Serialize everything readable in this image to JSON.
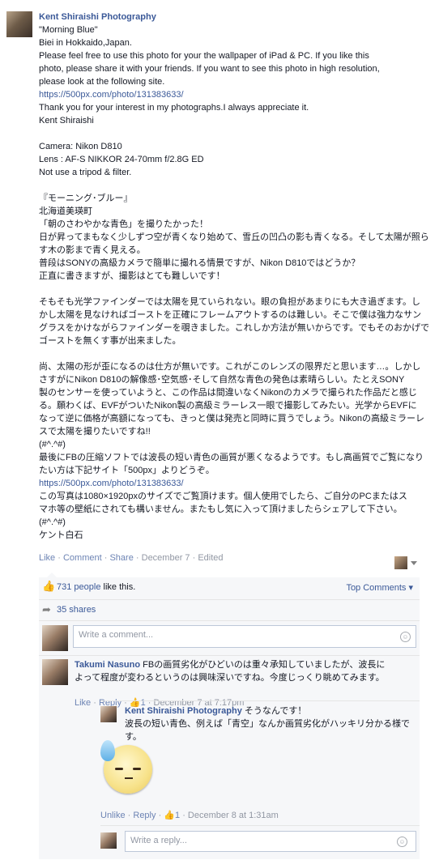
{
  "post": {
    "author": "Kent Shiraishi Photography",
    "lines": [
      "\"Morning Blue\"",
      "Biei in Hokkaido,Japan.",
      "Please feel free to use this photo for your the wallpaper of iPad & PC. If you like this",
      "photo, please share it with your friends. If you want to see this photo in high resolution,",
      "please look at the following site.",
      "https://500px.com/photo/131383633/",
      "Thank you for your interest in my photographs.I always appreciate it.",
      "Kent Shiraishi",
      "",
      "Camera: Nikon D810",
      "Lens : AF-S NIKKOR 24-70mm f/2.8G ED",
      "Not use a tripod & filter.",
      "",
      "『モーニング･ブルー』",
      "北海道美瑛町",
      "「朝のさわやかな青色」を撮りたかった！",
      "日が昇ってまもなく少しずつ空が青くなり始めて、雪丘の凹凸の影も青くなる。そして太陽が照ら",
      "す木の影まで青く見える。",
      "普段はSONYの高級カメラで簡単に撮れる情景ですが、Nikon D810ではどうか？",
      "正直に書きますが、撮影はとても難しいです！",
      "",
      "そもそも光学ファインダーでは太陽を見ていられない。眼の負担があまりにも大き過ぎます。し",
      "かし太陽を見なければゴーストを正確にフレームアウトするのは難しい。そこで僕は強力なサン",
      "グラスをかけながらファインダーを覗きました。これしか方法が無いからです。でもそのおかげで",
      "ゴーストを無くす事が出来ました。",
      "",
      "尚、太陽の形が歪になるのは仕方が無いです。これがこのレンズの限界だと思います…。しかし",
      "さすがにNikon D810の解像感･空気感･そして自然な青色の発色は素晴らしい。たとえSONY",
      "製のセンサーを使っていようと、この作品は間違いなくNikonのカメラで撮られた作品だと感じ",
      "る。願わくば、EVFがついたNikon製の高級ミラーレス一眼で撮影してみたい。光学からEVFに",
      "なって逆に価格が高額になっても、きっと僕は発売と同時に買うでしょう。Nikonの高級ミラーレ",
      "スで太陽を撮りたいですね!!",
      "(#^.^#)",
      "最後にFBの圧縮ソフトでは波長の短い青色の画質が悪くなるようです。もし高画質でご覧になり",
      "たい方は下記サイト「500px」よりどうぞ。",
      "https://500px.com/photo/131383633/",
      "この写真は1080×1920pxのサイズでご覧頂けます。個人使用でしたら、ご自分のPCまたはス",
      "マホ等の壁紙にされても構いません。またもし気に入って頂けましたらシェアして下さい。",
      "(#^.^#)",
      "ケント白石"
    ],
    "actions": {
      "like": "Like",
      "comment": "Comment",
      "share": "Share",
      "date": "December 7",
      "edited": "Edited",
      "sep": "·"
    }
  },
  "ufi": {
    "likes_count": "731 people",
    "likes_suffix": " like this.",
    "top_comments": "Top Comments ▾",
    "shares": "35 shares",
    "comment_placeholder": "Write a comment...",
    "reply_placeholder": "Write a reply..."
  },
  "comments": [
    {
      "name": "Takumi Nasuno",
      "text": "FBの画質劣化がひどいのは重々承知していましたが、波長に",
      "text2": "よって程度が変わるというのは興味深いですね。今度じっくり眺めてみます。",
      "like": "Like",
      "reply": "Reply",
      "likes": "1",
      "time": "December 7 at 7:17pm"
    }
  ],
  "reply": {
    "name": "Kent Shiraishi Photography",
    "text": "そうなんです！",
    "text2": "波長の短い青色、例えば「青空」なんか画質劣化がハッキリ分かる様で",
    "text3": "す。",
    "unlike": "Unlike",
    "reply": "Reply",
    "likes": "1",
    "time": "December 8 at 1:31am"
  }
}
